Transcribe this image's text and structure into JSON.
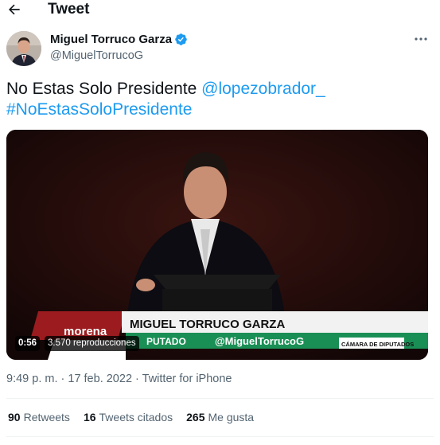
{
  "header": {
    "title": "Tweet",
    "back_icon": "arrow-left-icon"
  },
  "author": {
    "display_name": "Miguel Torruco Garza",
    "handle": "@MiguelTorrucoG",
    "verified": true,
    "verified_color": "#1d9bf0"
  },
  "tweet": {
    "text": "No Estas Solo Presidente ",
    "mention": "@lopezobrador_",
    "hashtag": "#NoEstasSoloPresidente",
    "link_color": "#1d9bf0"
  },
  "video": {
    "duration": "0:56",
    "views": "3.570 reproducciones",
    "lower_third": {
      "party": "morena",
      "name": "MIGUEL TORRUCO GARZA",
      "role": "PUTADO",
      "handle": "@MiguelTorrucoG",
      "chamber": "CÁMARA DE DIPUTADOS"
    }
  },
  "meta": {
    "time": "9:49 p. m.",
    "sep": " · ",
    "date": "17 feb. 2022",
    "source": "Twitter for iPhone"
  },
  "stats": {
    "retweets_count": "90",
    "retweets_label": "Retweets",
    "quotes_count": "16",
    "quotes_label": "Tweets citados",
    "likes_count": "265",
    "likes_label": "Me gusta"
  }
}
